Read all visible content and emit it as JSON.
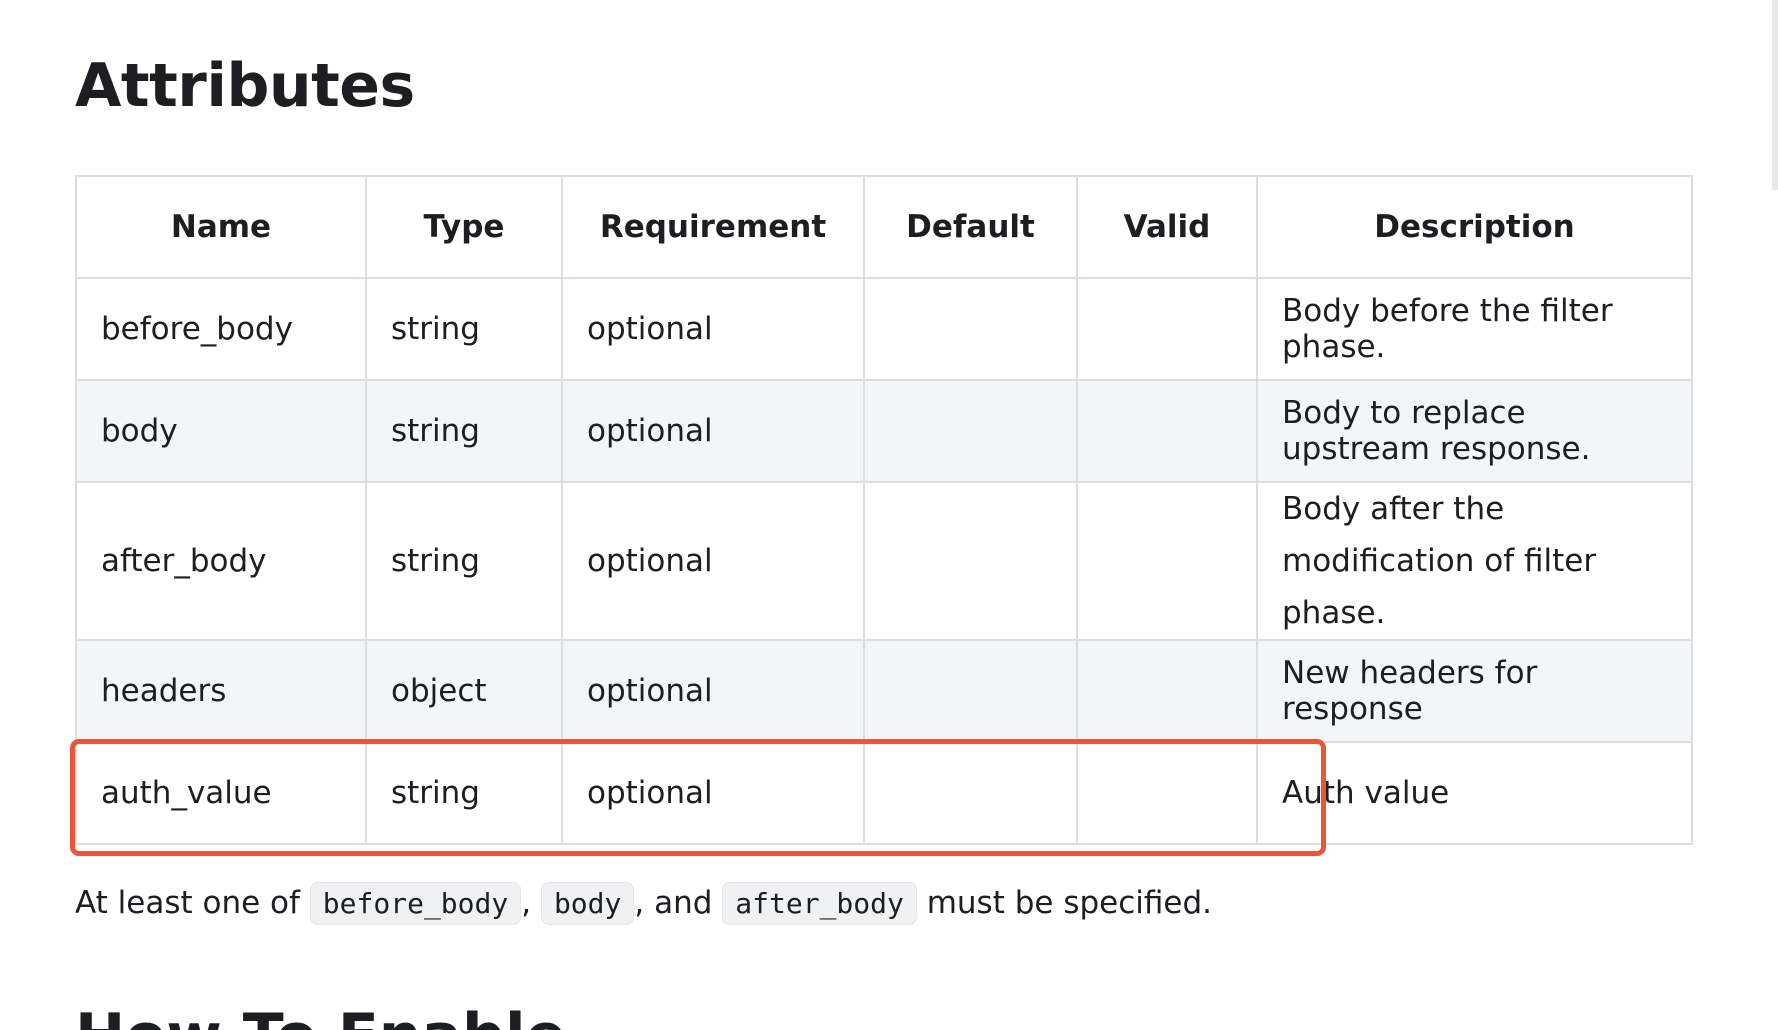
{
  "heading": "Attributes",
  "table": {
    "headers": [
      "Name",
      "Type",
      "Requirement",
      "Default",
      "Valid",
      "Description"
    ],
    "rows": [
      {
        "name": "before_body",
        "type": "string",
        "requirement": "optional",
        "default": "",
        "valid": "",
        "description": "Body before the filter phase."
      },
      {
        "name": "body",
        "type": "string",
        "requirement": "optional",
        "default": "",
        "valid": "",
        "description": "Body to replace upstream response."
      },
      {
        "name": "after_body",
        "type": "string",
        "requirement": "optional",
        "default": "",
        "valid": "",
        "description": "Body after the modification of filter phase."
      },
      {
        "name": "headers",
        "type": "object",
        "requirement": "optional",
        "default": "",
        "valid": "",
        "description": "New headers for response"
      },
      {
        "name": "auth_value",
        "type": "string",
        "requirement": "optional",
        "default": "",
        "valid": "",
        "description": "Auth value"
      }
    ]
  },
  "note": {
    "prefix": "At least one of ",
    "code1": "before_body",
    "sep1": ", ",
    "code2": "body",
    "sep2": ", and ",
    "code3": "after_body",
    "suffix": " must be specified."
  },
  "next_heading": "How To Enable",
  "colors": {
    "highlight": "#e8553a",
    "stripe": "#f4f5f7",
    "border": "#dadde1"
  }
}
